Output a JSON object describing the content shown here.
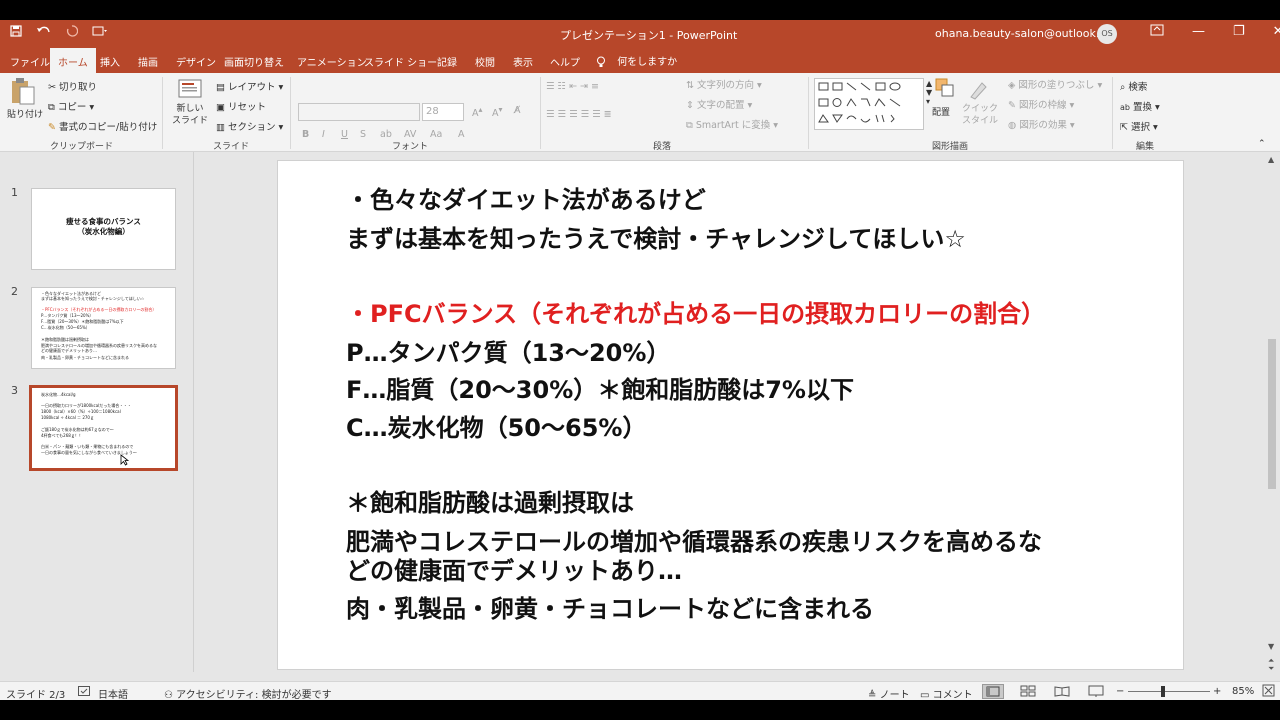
{
  "window": {
    "doc_title": "プレゼンテーション1 - PowerPoint",
    "account": "ohana.beauty-salon@outlook.jp",
    "avatar_initials": "OS",
    "minimize": "—",
    "restore": "❐",
    "close": "✕"
  },
  "tabs": [
    "ファイル",
    "ホーム",
    "挿入",
    "描画",
    "デザイン",
    "画面切り替え",
    "アニメーション",
    "スライド ショー",
    "記録",
    "校閲",
    "表示",
    "ヘルプ"
  ],
  "active_tab": "ホーム",
  "tell_me": "何をしますか",
  "ribbon": {
    "clipboard": {
      "paste": "貼り付け",
      "cut": "切り取り",
      "copy": "コピー",
      "format_painter": "書式のコピー/貼り付け",
      "label": "クリップボード"
    },
    "slides": {
      "new_slide": "新しい\nスライド",
      "layout": "レイアウト",
      "reset": "リセット",
      "section": "セクション",
      "label": "スライド"
    },
    "font": {
      "size": "28",
      "label": "フォント",
      "bold": "B",
      "italic": "I",
      "underline": "U",
      "shadow": "S"
    },
    "paragraph": {
      "text_direction": "文字列の方向",
      "align_text": "文字の配置",
      "smartart": "SmartArt に変換",
      "label": "段落"
    },
    "drawing": {
      "arrange": "配置",
      "quick_styles": "クイック\nスタイル",
      "fill": "図形の塗りつぶし",
      "outline": "図形の枠線",
      "effects": "図形の効果",
      "label": "図形描画"
    },
    "editing": {
      "find": "検索",
      "replace": "置換",
      "select": "選択",
      "label": "編集"
    }
  },
  "thumbnails": [
    {
      "num": "1",
      "title": "痩せる食事のバランス\n（炭水化物編）"
    },
    {
      "num": "2",
      "lines": [
        "・色々なダイエット法があるけど",
        "まずは基本を知ったうえで検討・チャレンジしてほしい☆",
        "",
        "・PFCバランス（それぞれが占める一日の摂取カロリーの割合）",
        "P…タンパク質（13〜20%）",
        "F…脂質（20〜30%）＊飽和脂肪酸は7%以下",
        "C…炭水化物（50〜65%）",
        "",
        "＊飽和脂肪酸は過剰摂取は",
        "肥満やコレステロールの増加や循環器系の疾患リスクを高めるな",
        "どの健康面でデメリットあり…",
        "肉・乳製品・卵黄・チョコレートなどに含まれる"
      ]
    },
    {
      "num": "3",
      "lines": [
        "炭水化物…4kcal/g",
        "",
        "一日の摂取カロリーが1800kcalだった場合・・・",
        "1800（kcal）×60（%）÷100＝1080kcal",
        "1080kcal ÷ 4kcal ＝ 270ｇ",
        "",
        "ご飯180ｇで炭水化物は約67ｇなので〜",
        "4杯食べても268ｇ！！",
        "",
        "白米・パン・麺類・いも類・果物にも含まれるので",
        "一日の食事の量を気にしながら食べていきましょう〜"
      ]
    }
  ],
  "slide": {
    "lines": [
      {
        "text": "・色々なダイエット法があるけど",
        "red": false
      },
      {
        "text": "まずは基本を知ったうえで検討・チャレンジしてほしい☆",
        "red": false
      },
      {
        "text": "・PFCバランス（それぞれが占める一日の摂取カロリーの割合）",
        "red": true
      },
      {
        "text": "P…タンパク質（13〜20%）",
        "red": false
      },
      {
        "text": "F…脂質（20〜30%）＊飽和脂肪酸は7%以下",
        "red": false
      },
      {
        "text": "C…炭水化物（50〜65%）",
        "red": false
      },
      {
        "text": "＊飽和脂肪酸は過剰摂取は",
        "red": false
      },
      {
        "text": "肥満やコレステロールの増加や循環器系の疾患リスクを高めるな",
        "red": false
      },
      {
        "text": "どの健康面でデメリットあり…",
        "red": false
      },
      {
        "text": "肉・乳製品・卵黄・チョコレートなどに含まれる",
        "red": false
      }
    ]
  },
  "status": {
    "slide_indicator": "スライド 2/3",
    "language": "日本語",
    "accessibility": "アクセシビリティ: 検討が必要です",
    "notes": "ノート",
    "comments": "コメント",
    "zoom": "85%",
    "zoom_fraction": 0.43
  },
  "colors": {
    "accent": "#b7472a",
    "emphasis_red": "#e02020"
  }
}
